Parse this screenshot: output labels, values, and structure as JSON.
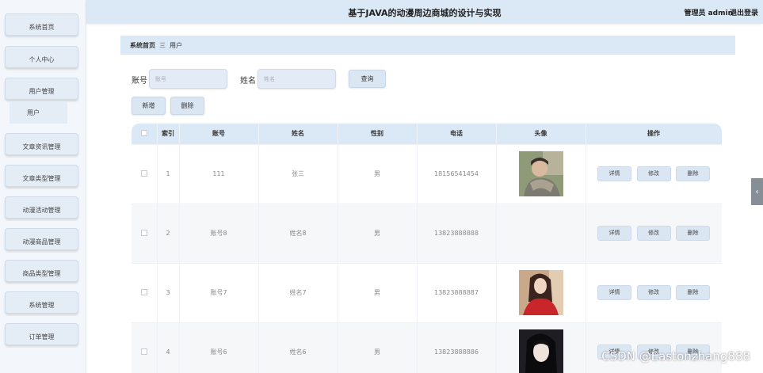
{
  "header": {
    "title": "基于JAVA的动漫周边商城的设计与实现",
    "user": "管理员 admin",
    "logout": "退出登录"
  },
  "sidebar": {
    "items": [
      {
        "label": "系统首页"
      },
      {
        "label": "个人中心"
      },
      {
        "label": "用户管理"
      },
      {
        "label": "文章资讯管理"
      },
      {
        "label": "文章类型管理"
      },
      {
        "label": "动漫活动管理"
      },
      {
        "label": "动漫商品管理"
      },
      {
        "label": "商品类型管理"
      },
      {
        "label": "系统管理"
      },
      {
        "label": "订单管理"
      }
    ],
    "sub_item": "用户"
  },
  "breadcrumb": {
    "home": "系统首页",
    "separator": "三",
    "current": "用户"
  },
  "search": {
    "account_label": "账号",
    "account_placeholder": "账号",
    "name_label": "姓名",
    "name_placeholder": "姓名",
    "query_button": "查询"
  },
  "actions": {
    "add": "新增",
    "delete": "删除"
  },
  "table": {
    "headers": [
      "",
      "索引",
      "账号",
      "姓名",
      "性别",
      "电话",
      "头像",
      "操作"
    ],
    "rows": [
      {
        "index": "1",
        "account": "111",
        "name": "张三",
        "gender": "男",
        "phone": "18156541454",
        "avatar": "avatar-photo-1"
      },
      {
        "index": "2",
        "account": "账号8",
        "name": "姓名8",
        "gender": "男",
        "phone": "13823888888",
        "avatar": ""
      },
      {
        "index": "3",
        "account": "账号7",
        "name": "姓名7",
        "gender": "男",
        "phone": "13823888887",
        "avatar": "avatar-photo-2"
      },
      {
        "index": "4",
        "account": "账号6",
        "name": "姓名6",
        "gender": "男",
        "phone": "13823888886",
        "avatar": "avatar-photo-3"
      }
    ],
    "ops": {
      "detail": "详情",
      "edit": "修改",
      "delete": "删除"
    }
  },
  "watermark": "CSDN @Eastonzhang888",
  "side_arrow": "‹",
  "colors": {
    "header_bg": "#dbe8f6",
    "button_bg": "#dbe6f3",
    "sidebar_bg": "#f3f6fa"
  }
}
